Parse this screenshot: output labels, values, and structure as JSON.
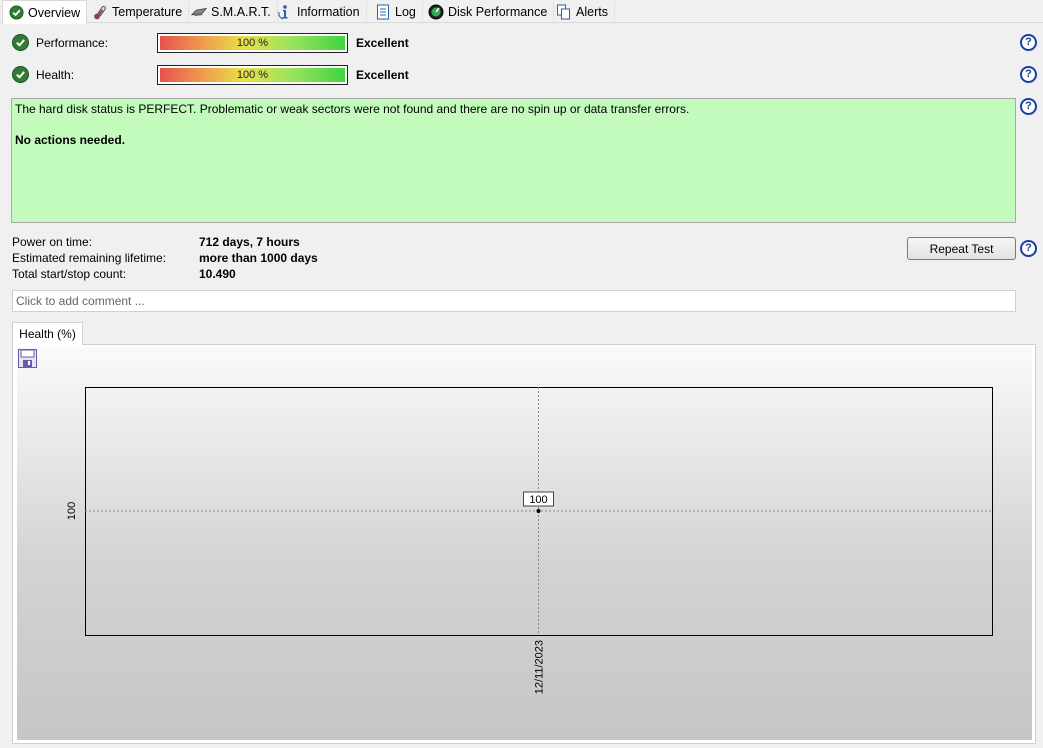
{
  "tabs": [
    {
      "label": "Overview",
      "icon": "check-circle-icon",
      "active": true
    },
    {
      "label": "Temperature",
      "icon": "thermometer-icon",
      "active": false
    },
    {
      "label": "S.M.A.R.T.",
      "icon": "smart-chip-icon",
      "active": false
    },
    {
      "label": "Information",
      "icon": "info-icon",
      "active": false
    },
    {
      "label": "Log",
      "icon": "log-document-icon",
      "active": false
    },
    {
      "label": "Disk Performance",
      "icon": "gauge-icon",
      "active": false
    },
    {
      "label": "Alerts",
      "icon": "alerts-pages-icon",
      "active": false
    }
  ],
  "performance": {
    "label": "Performance:",
    "value_text": "100 %",
    "value": 100,
    "rating": "Excellent"
  },
  "health": {
    "label": "Health:",
    "value_text": "100 %",
    "value": 100,
    "rating": "Excellent"
  },
  "status": {
    "message": "The hard disk status is PERFECT. Problematic or weak sectors were not found and there are no spin up or data transfer errors.",
    "action": "No actions needed.",
    "background": "#c3fbbd"
  },
  "info": {
    "power_on_label": "Power on time:",
    "power_on_value": "712 days, 7 hours",
    "lifetime_label": "Estimated remaining lifetime:",
    "lifetime_value": "more than 1000 days",
    "startstop_label": "Total start/stop count:",
    "startstop_value": "10.490"
  },
  "repeat_button": "Repeat Test",
  "comment": {
    "placeholder": "Click to add comment ..."
  },
  "chart_tab": "Health (%)",
  "colors": {
    "accent_check": "#2f7d32",
    "help_blue": "#1a3fa0"
  },
  "chart_data": {
    "type": "line",
    "x": [
      "12/11/2023"
    ],
    "series": [
      {
        "values": [
          100
        ]
      }
    ],
    "data_labels": [
      "100"
    ],
    "y_ticks": [
      "100"
    ],
    "x_ticks": [
      "12/11/2023"
    ],
    "title": "",
    "xlabel": "",
    "ylabel": "",
    "grid": "dotted crosshair at data point"
  }
}
